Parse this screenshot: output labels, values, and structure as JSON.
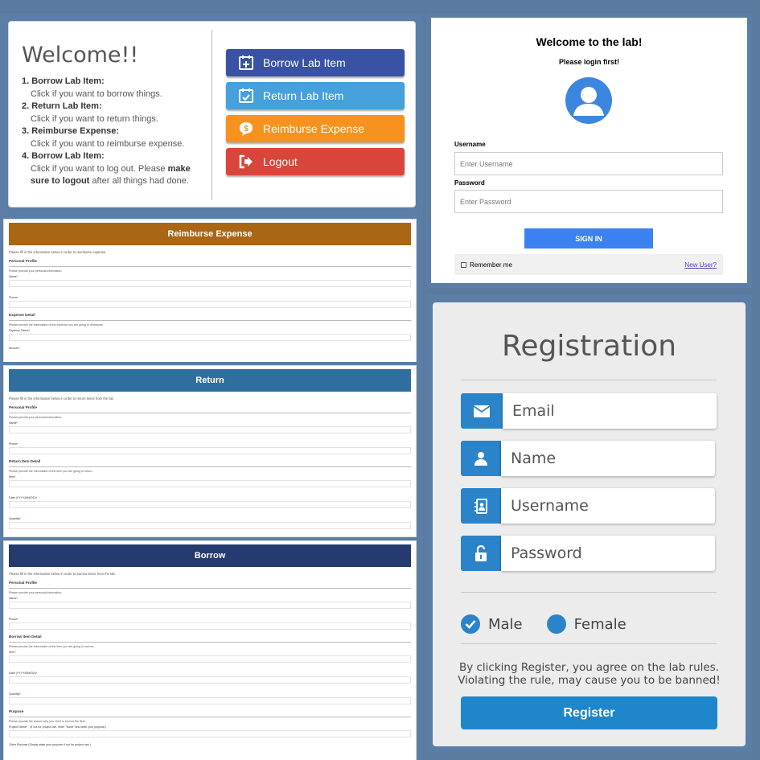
{
  "welcome": {
    "title": "Welcome!!",
    "items": [
      {
        "heading": "1. Borrow Lab Item:",
        "desc": "Click if you want to borrow things."
      },
      {
        "heading": "2. Return Lab Item:",
        "desc": "Click if you want to return things."
      },
      {
        "heading": "3. Reimburse Expense:",
        "desc": "Click if you want to reimburse expense."
      },
      {
        "heading": "4. Borrow Lab Item:",
        "desc_a": "Click if you want to log out. Please ",
        "desc_b": "make sure to logout",
        "desc_c": " after all things had done."
      }
    ],
    "buttons": [
      {
        "label": "Borrow Lab Item",
        "color": "#3a52a3",
        "icon": "calendar-plus-icon"
      },
      {
        "label": "Return Lab Item",
        "color": "#46a0db",
        "icon": "calendar-check-icon"
      },
      {
        "label": "Reimburse Expense",
        "color": "#f7921e",
        "icon": "money-icon"
      },
      {
        "label": "Logout",
        "color": "#d9453a",
        "icon": "logout-icon"
      }
    ]
  },
  "login": {
    "title": "Welcome to the lab!",
    "subtitle": "Please login first!",
    "username_label": "Username",
    "username_placeholder": "Enter Username",
    "password_label": "Password",
    "password_placeholder": "Enter Password",
    "signin_label": "SIGN IN",
    "remember_label": "Remember me",
    "new_user_label": "New User?"
  },
  "reimburse": {
    "header": "Reimburse Expense",
    "header_color": "#a96615",
    "intro": "Please fill in the information below in order to reimburse expense.",
    "section1": "Personal Profile",
    "section1_desc": "Please provide your personal information.",
    "field_name": "Name",
    "field_phone": "Phone",
    "section2": "Expense Detail",
    "section2_desc": "Please provide the information of the expense you are going to reimburse.",
    "field_expense": "Expense Name",
    "field_amount": "Amount"
  },
  "return": {
    "header": "Return",
    "header_color": "#2f6f9f",
    "intro": "Please fill in the information below in order to return items from the lab.",
    "section1": "Personal Profile",
    "section1_desc": "Please provide your personal information.",
    "field_name": "Name",
    "field_phone": "Phone",
    "section2": "Return Item Detail",
    "section2_desc": "Please provide the information of the item you are going to return.",
    "field_item": "Item",
    "field_date": "Date (YYYY/MM/DD)",
    "field_quantity": "Quantity"
  },
  "borrow": {
    "header": "Borrow",
    "header_color": "#253a6e",
    "intro": "Please fill in the information below in order to borrow items from the lab.",
    "section1": "Personal Profile",
    "section1_desc": "Please provide your personal information.",
    "field_name": "Name",
    "field_phone": "Phone",
    "section2": "Borrow Item Detail",
    "section2_desc": "Please provide the information of the item you are going to borrow.",
    "field_item": "Item",
    "field_date": "Date (YYYY/MM/DD)",
    "field_quantity": "Quantity",
    "section3": "Purpose",
    "section3_desc": "Please provide the reason why you need to borrow the item.",
    "field_project": "Project Name",
    "field_project_hint": "(If not for project use, enter \"None\" and write your purpose.)",
    "field_other": "Other Purpose (Simply state your purpose if not for project use.)"
  },
  "registration": {
    "title": "Registration",
    "fields": [
      {
        "placeholder": "Email",
        "icon": "envelope-icon"
      },
      {
        "placeholder": "Name",
        "icon": "user-icon"
      },
      {
        "placeholder": "Username",
        "icon": "contact-book-icon"
      },
      {
        "placeholder": "Password",
        "icon": "unlock-icon"
      }
    ],
    "gender_male": "Male",
    "gender_female": "Female",
    "male_selected": true,
    "terms_line1": "By clicking Register, you agree on the lab rules.",
    "terms_line2": "Violating the rule, may cause you to be banned!",
    "register_label": "Register",
    "accent_color": "#2b84c9"
  }
}
